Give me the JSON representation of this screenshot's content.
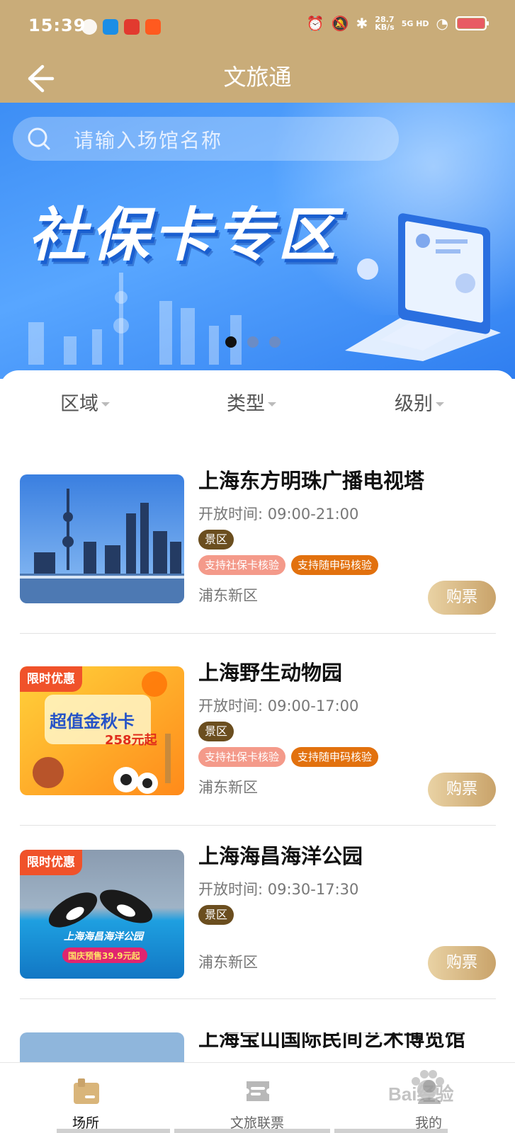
{
  "status_bar": {
    "time": "15:39",
    "net_speed_value": "28.7",
    "net_speed_unit": "KB/s",
    "network": "5G HD",
    "app_icons": [
      "wechat-icon",
      "message-icon",
      "app-icon",
      "taobao-icon"
    ],
    "right_icons": [
      "alarm-icon",
      "mute-icon",
      "bluetooth-icon",
      "signal-icon",
      "wifi-icon",
      "battery-icon"
    ]
  },
  "header": {
    "title": "文旅通",
    "back_icon": "back-arrow-icon"
  },
  "banner": {
    "search_placeholder": "请输入场馆名称",
    "headline": "社保卡专区",
    "slides": 3,
    "active_slide": 1
  },
  "filters": [
    {
      "label": "区域"
    },
    {
      "label": "类型"
    },
    {
      "label": "级别"
    }
  ],
  "venues": [
    {
      "name": "上海东方明珠广播电视塔",
      "hours": "开放时间: 09:00-21:00",
      "type": "景区",
      "tags": [
        "支持社保卡核验",
        "支持随申码核验"
      ],
      "district": "浦东新区",
      "buy_label": "购票",
      "promo": ""
    },
    {
      "name": "上海野生动物园",
      "hours": "开放时间: 09:00-17:00",
      "type": "景区",
      "tags": [
        "支持社保卡核验",
        "支持随申码核验"
      ],
      "district": "浦东新区",
      "buy_label": "购票",
      "promo": "限时优惠",
      "image_text": [
        "超值金秋卡",
        "258元起"
      ]
    },
    {
      "name": "上海海昌海洋公园",
      "hours": "开放时间: 09:30-17:30",
      "type": "景区",
      "tags": [],
      "district": "浦东新区",
      "buy_label": "购票",
      "promo": "限时优惠",
      "image_text": [
        "上海海昌海洋公园",
        "国庆预售39.9元起"
      ]
    },
    {
      "name": "上海宝山国际民间艺术博览馆"
    }
  ],
  "tabbar": [
    {
      "label": "场所",
      "icon": "venue-icon",
      "active": true
    },
    {
      "label": "文旅联票",
      "icon": "ticket-icon",
      "active": false
    },
    {
      "label": "我的",
      "icon": "profile-icon",
      "active": false
    }
  ],
  "watermark": "Bai经验",
  "colors": {
    "header_bg": "#c9ac79",
    "banner_blue": "#3d8ef5",
    "type_tag": "#6b4e1f",
    "sb_tag": "#f49a8a",
    "ssm_tag": "#e2710e",
    "buy_gradient_start": "#e9d2a4",
    "buy_gradient_end": "#c9a36a",
    "promo": "#f0522a"
  }
}
